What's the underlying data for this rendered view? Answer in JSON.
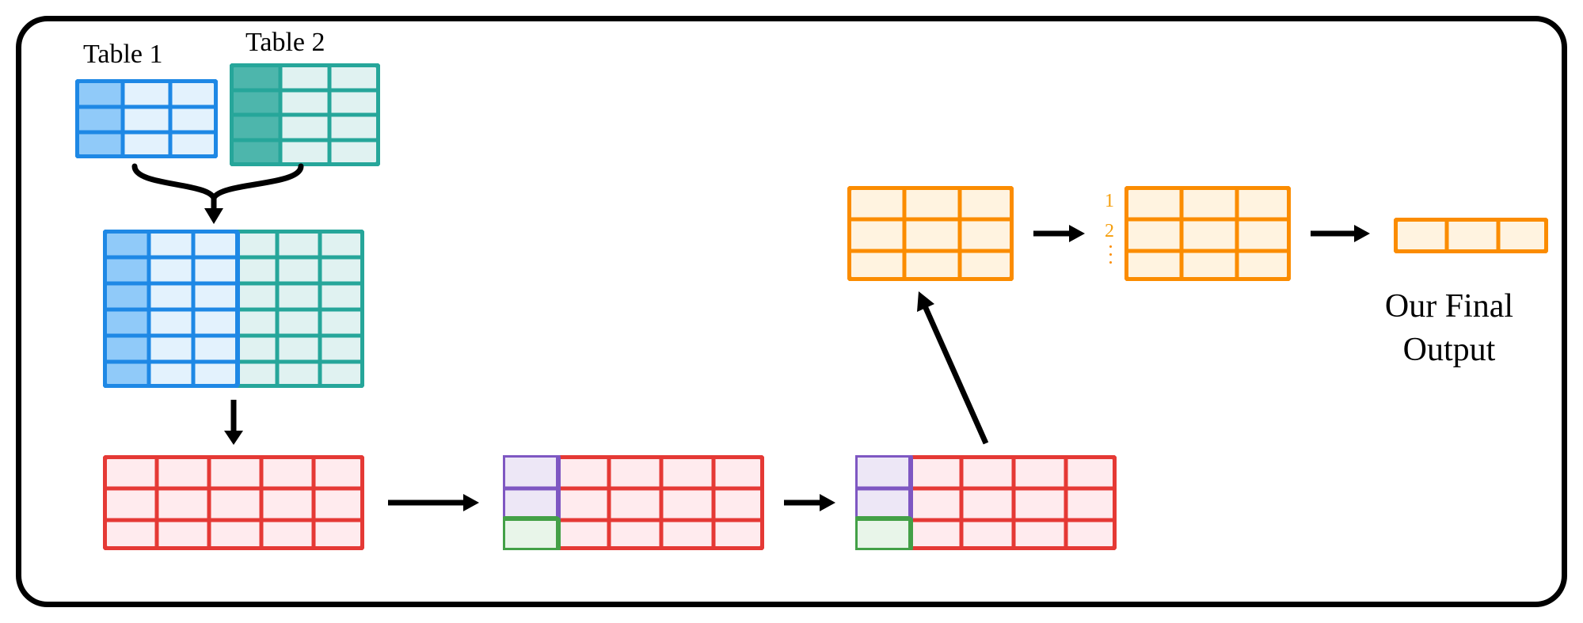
{
  "labels": {
    "table1": "Table 1",
    "table2": "Table 2",
    "final": "Our Final\nOutput",
    "sort1": "1",
    "sort2": "2"
  },
  "colors": {
    "blue_border": "#1e88e5",
    "blue_fill_dark": "#90caf9",
    "blue_fill_light": "#e3f2fd",
    "green_border": "#26a69a",
    "green_fill_dark": "#4db6ac",
    "green_fill_light": "#e0f2f1",
    "red_border": "#e53935",
    "red_fill": "#ffebee",
    "purple_border": "#7e57c2",
    "purple_fill": "#ede7f6",
    "lgreen_border": "#43a047",
    "lgreen_fill": "#e8f5e9",
    "orange_border": "#fb8c00",
    "orange_fill": "#fff3e0",
    "black": "#000000"
  },
  "diagram": {
    "description": "Data pipeline diagram: two input tables are joined, then filtered/processed through several intermediate tables, sorted, and reduced to a single-row final output.",
    "steps": [
      {
        "id": "table1",
        "shape": "grid",
        "rows": 3,
        "cols": 3,
        "header_col": true,
        "color": "blue"
      },
      {
        "id": "table2",
        "shape": "grid",
        "rows": 4,
        "cols": 3,
        "header_col": true,
        "color": "green"
      },
      {
        "id": "joined",
        "shape": "grid",
        "rows": 6,
        "cols": 6,
        "color": "blue+green",
        "note": "left 3 cols blue (header-col), right 3 cols green"
      },
      {
        "id": "red1",
        "shape": "grid",
        "rows": 3,
        "cols": 5,
        "color": "red"
      },
      {
        "id": "red2",
        "shape": "grid",
        "rows": 3,
        "cols": 5,
        "color": "red",
        "overlays": [
          {
            "color": "purple",
            "rows": 2,
            "cols": 1,
            "at": "top-left"
          },
          {
            "color": "lgreen",
            "rows": 1,
            "cols": 1,
            "at": "row3-col1"
          }
        ]
      },
      {
        "id": "red3",
        "shape": "grid",
        "rows": 3,
        "cols": 5,
        "color": "red",
        "overlays": [
          {
            "color": "purple",
            "rows": 2,
            "cols": 1,
            "at": "top-left"
          },
          {
            "color": "lgreen",
            "rows": 1,
            "cols": 1,
            "at": "row3-col1"
          }
        ]
      },
      {
        "id": "orange1",
        "shape": "grid",
        "rows": 3,
        "cols": 3,
        "color": "orange"
      },
      {
        "id": "orange2_sorted",
        "shape": "grid",
        "rows": 3,
        "cols": 3,
        "color": "orange",
        "note": "rows numbered 1..2.. indicating sort"
      },
      {
        "id": "output",
        "shape": "grid",
        "rows": 1,
        "cols": 3,
        "color": "orange"
      }
    ],
    "arrows": [
      {
        "from": [
          "table1",
          "table2"
        ],
        "to": "joined",
        "style": "brace-merge"
      },
      {
        "from": "joined",
        "to": "red1",
        "style": "down"
      },
      {
        "from": "red1",
        "to": "red2",
        "style": "right"
      },
      {
        "from": "red2",
        "to": "red3",
        "style": "right"
      },
      {
        "from": "red3",
        "to": "orange1",
        "style": "up-right"
      },
      {
        "from": "orange1",
        "to": "orange2_sorted",
        "style": "right"
      },
      {
        "from": "orange2_sorted",
        "to": "output",
        "style": "right"
      }
    ]
  }
}
